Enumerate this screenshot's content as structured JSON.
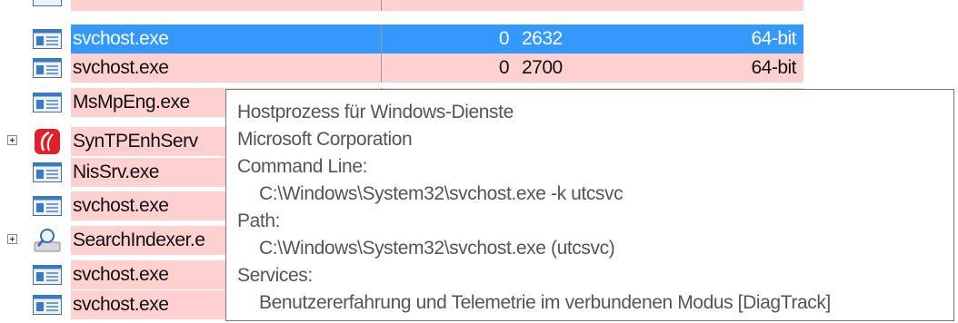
{
  "colors": {
    "row_background": "#ffd0d0",
    "selected_background": "#3399ff",
    "tooltip_border": "#767676"
  },
  "processes": [
    {
      "name": "svchost.exe",
      "cpu": "0",
      "pid": "2632",
      "arch": "64-bit",
      "icon": "service-host-icon",
      "selected": true
    },
    {
      "name": "svchost.exe",
      "cpu": "0",
      "pid": "2700",
      "arch": "64-bit",
      "icon": "service-host-icon",
      "selected": false
    },
    {
      "name": "MsMpEng.exe",
      "cpu": "",
      "pid": "",
      "arch": "",
      "icon": "service-host-icon",
      "selected": false
    },
    {
      "name": "SynTPEnhServ",
      "cpu": "",
      "pid": "",
      "arch": "",
      "icon": "synaptics-icon",
      "expandable": true
    },
    {
      "name": "NisSrv.exe",
      "cpu": "",
      "pid": "",
      "arch": "",
      "icon": "service-host-icon"
    },
    {
      "name": "svchost.exe",
      "cpu": "",
      "pid": "",
      "arch": "",
      "icon": "service-host-icon"
    },
    {
      "name": "SearchIndexer.e",
      "cpu": "",
      "pid": "",
      "arch": "",
      "icon": "search-indexer-icon",
      "expandable": true
    },
    {
      "name": "svchost.exe",
      "cpu": "",
      "pid": "",
      "arch": "",
      "icon": "service-host-icon"
    },
    {
      "name": "svchost.exe",
      "cpu": "",
      "pid": "",
      "arch": "",
      "icon": "service-host-icon"
    }
  ],
  "tooltip": {
    "description": "Hostprozess für Windows-Dienste",
    "company": "Microsoft Corporation",
    "command_line_label": "Command Line:",
    "command_line": "C:\\Windows\\System32\\svchost.exe -k utcsvc",
    "path_label": "Path:",
    "path": "C:\\Windows\\System32\\svchost.exe (utcsvc)",
    "services_label": "Services:",
    "services": "Benutzererfahrung und Telemetrie im verbundenen Modus [DiagTrack]"
  }
}
